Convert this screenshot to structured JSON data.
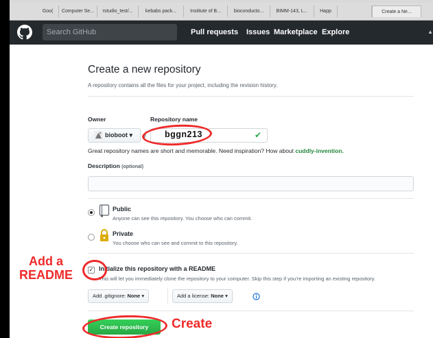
{
  "bookmarks": [
    "Goo(",
    "Computer Se...",
    "rstudio_test/...",
    "kebabs pack...",
    "Institute of B...",
    "bioconducto...",
    "BIMM-143, L...",
    "Happ",
    "",
    "Create a Ne..."
  ],
  "header": {
    "search_placeholder": "Search GitHub",
    "nav": [
      "Pull requests",
      "Issues",
      "Marketplace",
      "Explore"
    ]
  },
  "form": {
    "title": "Create a new repository",
    "subtitle": "A repository contains all the files for your project, including the revision history.",
    "owner_label": "Owner",
    "repo_label": "Repository name",
    "owner_value": "bioboot",
    "separator": "/",
    "repo_value": "bggn213",
    "hint_prefix": "Great repository names are short and memorable. Need inspiration? How about",
    "hint_name": "cuddly-invention.",
    "description_label": "Description",
    "description_optional": "(optional)",
    "public_title": "Public",
    "public_desc": "Anyone can see this repository. You choose who can commit.",
    "private_title": "Private",
    "private_desc": "You choose who can see and commit to this repository.",
    "readme_title": "Initialize this repository with a README",
    "readme_desc": "This will let you immediately clone the repository to your computer. Skip this step if you’re importing an existing repository.",
    "gitignore_prefix": "Add .gitignore:",
    "gitignore_value": "None",
    "license_prefix": "Add a license:",
    "license_value": "None",
    "create_label": "Create repository"
  },
  "annotations": {
    "readme_line1": "Add a",
    "readme_line2": "README",
    "create": "Create"
  },
  "colors": {
    "header": "#24292e",
    "accent_green": "#28a745",
    "annotation_red": "#ef2a2a"
  },
  "icons": [
    "github-octocat-icon",
    "repo-icon",
    "lock-icon",
    "info-icon",
    "checkmark-icon",
    "caret-down-icon"
  ]
}
